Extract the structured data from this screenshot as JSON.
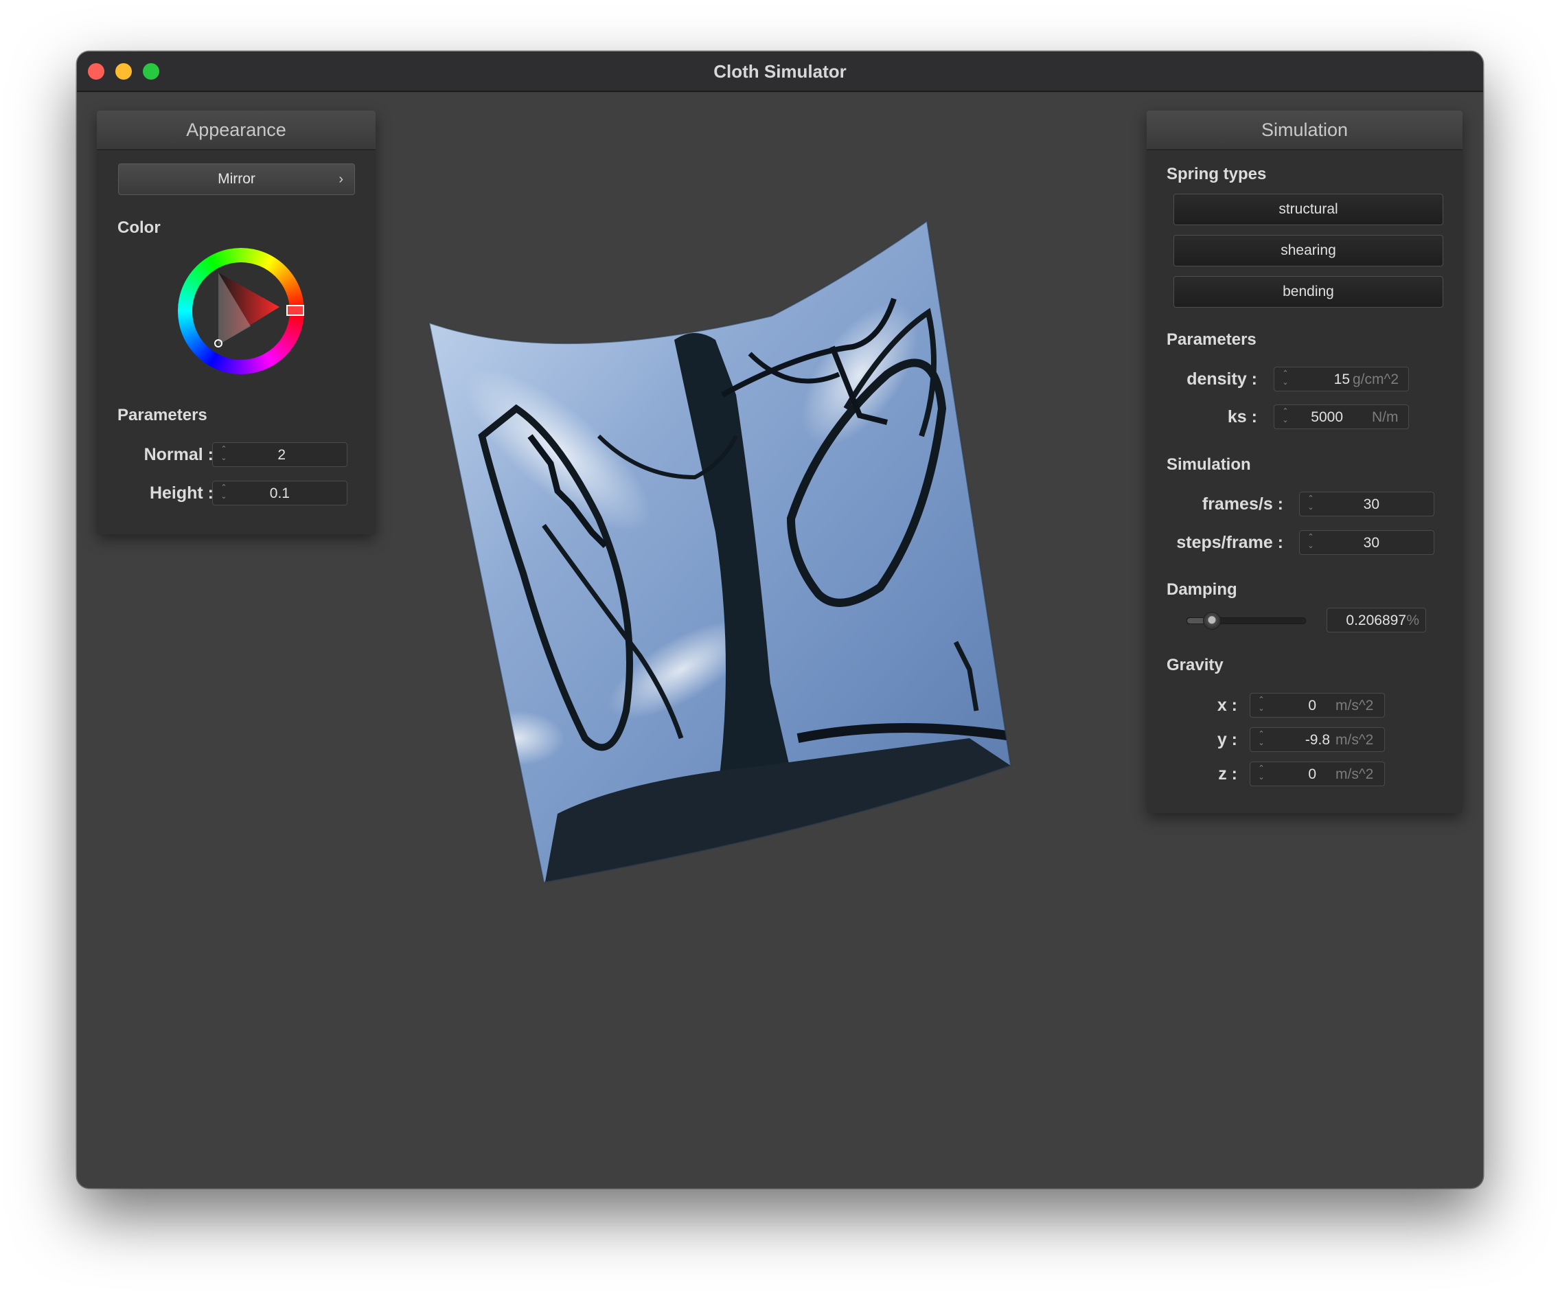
{
  "window": {
    "title": "Cloth Simulator"
  },
  "appearance": {
    "header": "Appearance",
    "shader_selected": "Mirror",
    "color_label": "Color",
    "color_value": "#ff3b3b",
    "parameters_label": "Parameters",
    "normal_label": "Normal :",
    "normal_value": "2",
    "height_label": "Height :",
    "height_value": "0.1"
  },
  "simulation": {
    "header": "Simulation",
    "spring_types_label": "Spring types",
    "springs": [
      "structural",
      "shearing",
      "bending"
    ],
    "parameters_label": "Parameters",
    "density_label": "density :",
    "density_value": "15",
    "density_unit": "g/cm^2",
    "ks_label": "ks :",
    "ks_value": "5000",
    "ks_unit": "N/m",
    "simulation_label": "Simulation",
    "fps_label": "frames/s :",
    "fps_value": "30",
    "steps_label": "steps/frame :",
    "steps_value": "30",
    "damping_label": "Damping",
    "damping_fraction": 0.206897,
    "damping_value": "0.206897",
    "damping_unit": "%",
    "gravity_label": "Gravity",
    "gx_label": "x :",
    "gx_value": "0",
    "gy_label": "y :",
    "gy_value": "-9.8",
    "gz_label": "z :",
    "gz_value": "0",
    "gravity_unit": "m/s^2"
  }
}
